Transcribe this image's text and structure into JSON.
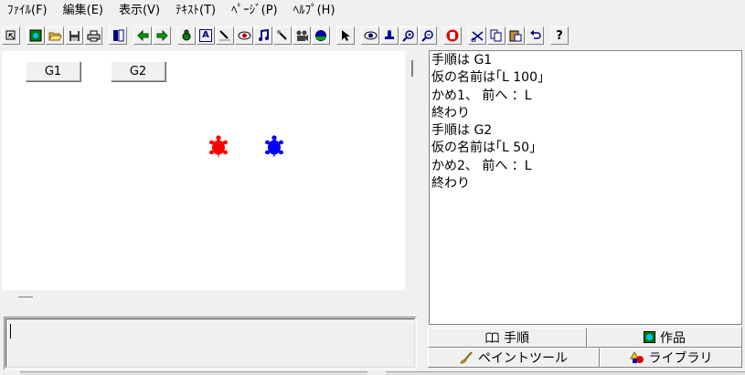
{
  "menu": [
    "ﾌｧｲﾙ(F)",
    "編集(E)",
    "表示(V)",
    "ﾃｷｽﾄ(T)",
    "ﾍﾟｰｼﾞ(P)",
    "ﾍﾙﾌﾟ(H)"
  ],
  "toolbar": {
    "text_tool_label": "A",
    "help_label": "?"
  },
  "canvas": {
    "buttons": [
      "G1",
      "G2"
    ],
    "turtle_colors": [
      "#ff0000",
      "#0000ff"
    ]
  },
  "script": {
    "lines": [
      "手順は G1",
      "仮の名前は｢L 100｣",
      "かめ1、 前へ ：L",
      "終わり",
      "手順は  G2",
      "仮の名前は｢L 50｣",
      "かめ2、 前へ ：L",
      "終わり"
    ]
  },
  "tabs": {
    "procedure": "手順",
    "works": "作品",
    "paint_tool": "ペイントツール",
    "library": "ライブラリ"
  }
}
